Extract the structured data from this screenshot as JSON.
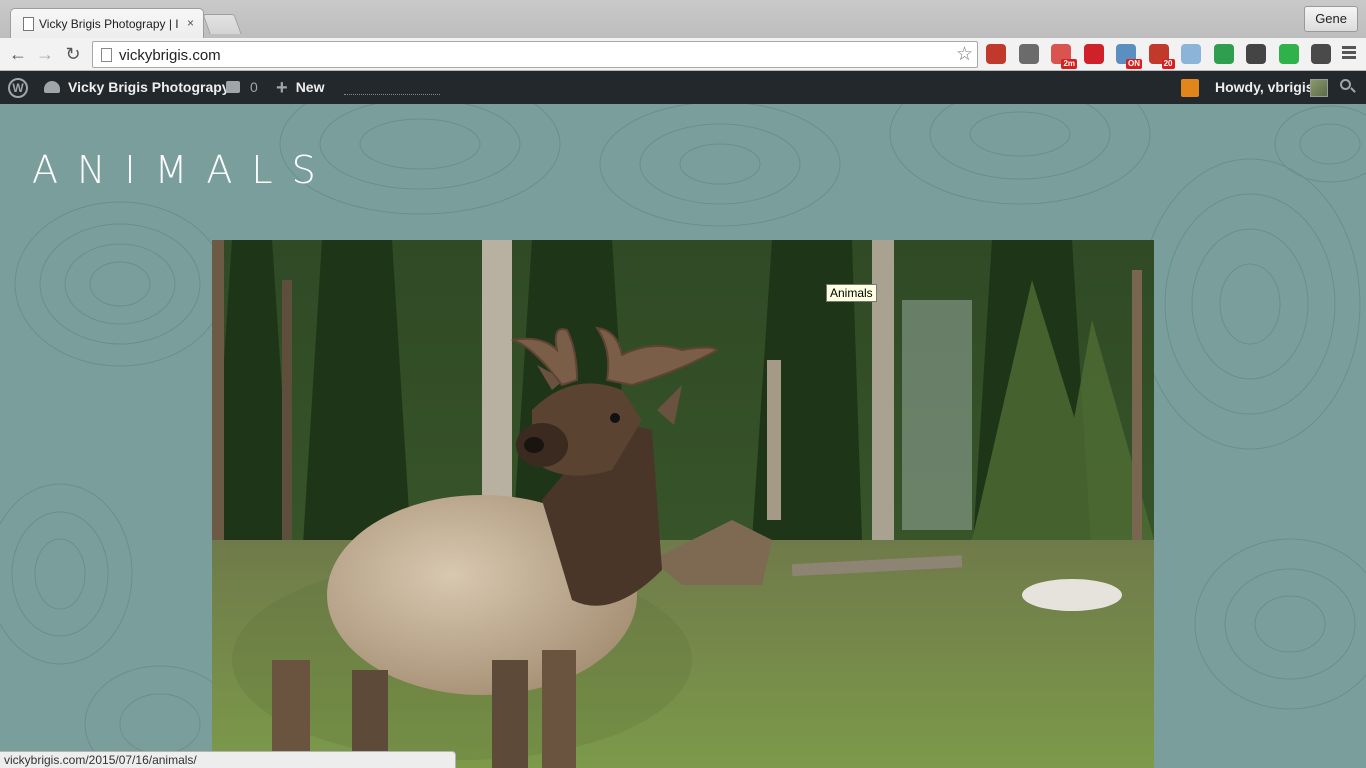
{
  "browser": {
    "tab_title": "Vicky Brigis Photograpy | I",
    "tab_close": "×",
    "profile_label": "Gene",
    "url": "vickybrigis.com",
    "back_icon": "←",
    "forward_icon": "→",
    "reload_icon": "↻",
    "star_icon": "☆",
    "extensions": [
      {
        "name": "bug-icon",
        "color": "#c0392b",
        "badge": ""
      },
      {
        "name": "pocket-icon",
        "color": "#6b6b6b",
        "badge": ""
      },
      {
        "name": "timer-icon",
        "color": "#d9534f",
        "badge": "2m"
      },
      {
        "name": "asterisk-icon",
        "color": "#d0202a",
        "badge": ""
      },
      {
        "name": "weather-icon",
        "color": "#5a8fc0",
        "badge": "ON"
      },
      {
        "name": "lastpass-icon",
        "color": "#c0392b",
        "badge": "20"
      },
      {
        "name": "camera-icon",
        "color": "#8cb4d8",
        "badge": ""
      },
      {
        "name": "hangouts-icon",
        "color": "#2e9e4f",
        "badge": ""
      },
      {
        "name": "sync-icon",
        "color": "#444444",
        "badge": ""
      },
      {
        "name": "pushbullet-icon",
        "color": "#2fb24a",
        "badge": ""
      },
      {
        "name": "h-icon",
        "color": "#4a4a4a",
        "badge": ""
      }
    ],
    "status_url": "vickybrigis.com/2015/07/16/animals/"
  },
  "adminbar": {
    "site_name": "Vicky Brigis Photograpy",
    "comments_count": "0",
    "new_label": "New",
    "howdy": "Howdy, vbrigis"
  },
  "page": {
    "heading": "ANIMALS",
    "tooltip": "Animals",
    "photo_subject": "elk-photo",
    "bg_color": "#7a9e9c"
  }
}
